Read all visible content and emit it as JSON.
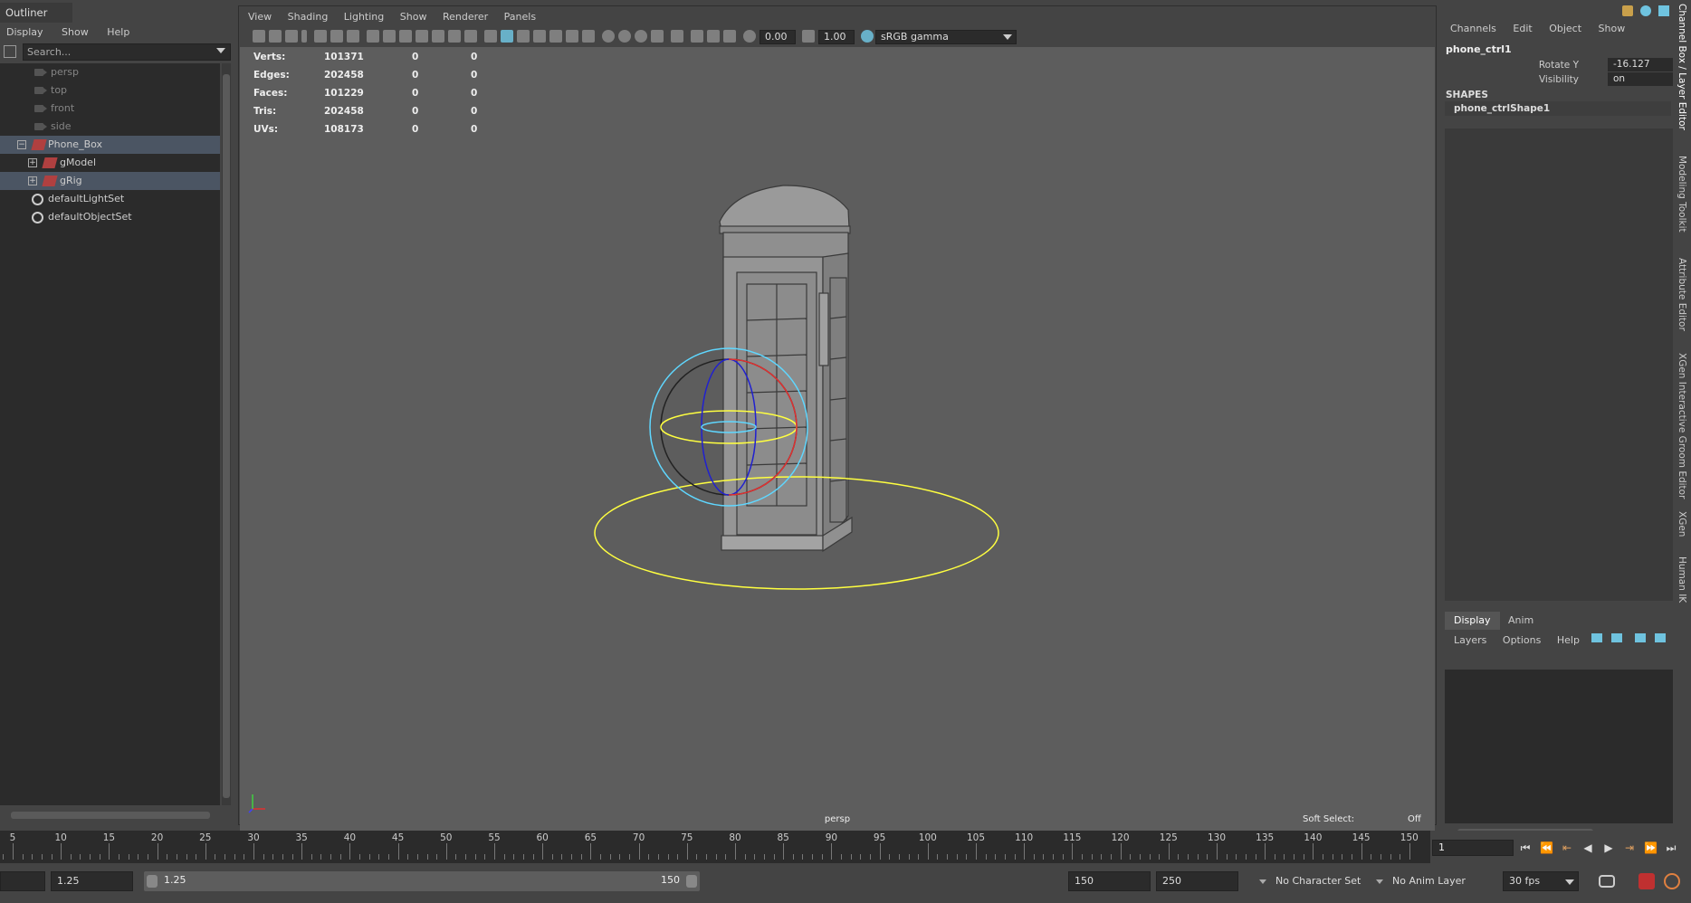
{
  "outliner": {
    "title": "Outliner",
    "menu": [
      "Display",
      "Show",
      "Help"
    ],
    "search_placeholder": "Search...",
    "items": [
      {
        "label": "persp"
      },
      {
        "label": "top"
      },
      {
        "label": "front"
      },
      {
        "label": "side"
      },
      {
        "label": "Phone_Box"
      },
      {
        "label": "gModel"
      },
      {
        "label": "gRig"
      },
      {
        "label": "defaultLightSet"
      },
      {
        "label": "defaultObjectSet"
      }
    ]
  },
  "viewport": {
    "menu": [
      "View",
      "Shading",
      "Lighting",
      "Show",
      "Renderer",
      "Panels"
    ],
    "exposure": "0.00",
    "gamma": "1.00",
    "color_space": "sRGB gamma",
    "hud": [
      {
        "label": "Verts:",
        "v1": "101371",
        "v2": "0",
        "v3": "0"
      },
      {
        "label": "Edges:",
        "v1": "202458",
        "v2": "0",
        "v3": "0"
      },
      {
        "label": "Faces:",
        "v1": "101229",
        "v2": "0",
        "v3": "0"
      },
      {
        "label": "Tris:",
        "v1": "202458",
        "v2": "0",
        "v3": "0"
      },
      {
        "label": "UVs:",
        "v1": "108173",
        "v2": "0",
        "v3": "0"
      }
    ],
    "camera": "persp",
    "soft_select_label": "Soft Select:",
    "soft_select_value": "Off"
  },
  "channel_box": {
    "menu": [
      "Channels",
      "Edit",
      "Object",
      "Show"
    ],
    "node": "phone_ctrl1",
    "attrs": [
      {
        "name": "Rotate Y",
        "value": "-16.127"
      },
      {
        "name": "Visibility",
        "value": "on"
      }
    ],
    "shapes_header": "SHAPES",
    "shape": "phone_ctrlShape1"
  },
  "layer_editor": {
    "tabs": [
      "Display",
      "Anim"
    ],
    "menu": [
      "Layers",
      "Options",
      "Help"
    ]
  },
  "side_tabs": [
    "Channel Box / Layer Editor",
    "Modeling Toolkit",
    "Attribute Editor",
    "XGen Interactive Groom Editor",
    "XGen",
    "Human IK"
  ],
  "timeline": {
    "labels": [
      "5",
      "10",
      "15",
      "20",
      "25",
      "30",
      "35",
      "40",
      "45",
      "50",
      "55",
      "60",
      "65",
      "70",
      "75",
      "80",
      "85",
      "90",
      "95",
      "100",
      "105",
      "110",
      "115",
      "120",
      "125",
      "130",
      "135",
      "140",
      "145",
      "150"
    ],
    "current_frame": "1"
  },
  "range": {
    "start": "1.25",
    "slider_start": "1.25",
    "slider_end": "150",
    "end": "150",
    "anim_end": "250",
    "character_set": "No Character Set",
    "anim_layer": "No Anim Layer",
    "fps": "30 fps"
  },
  "colors": {
    "selection_yellow": "#ffff40",
    "ctrl_cyan": "#5fd7ff",
    "ctrl_red": "#e03030",
    "ctrl_blue": "#2020d0",
    "viewport_bg": "#5d5d5d"
  }
}
